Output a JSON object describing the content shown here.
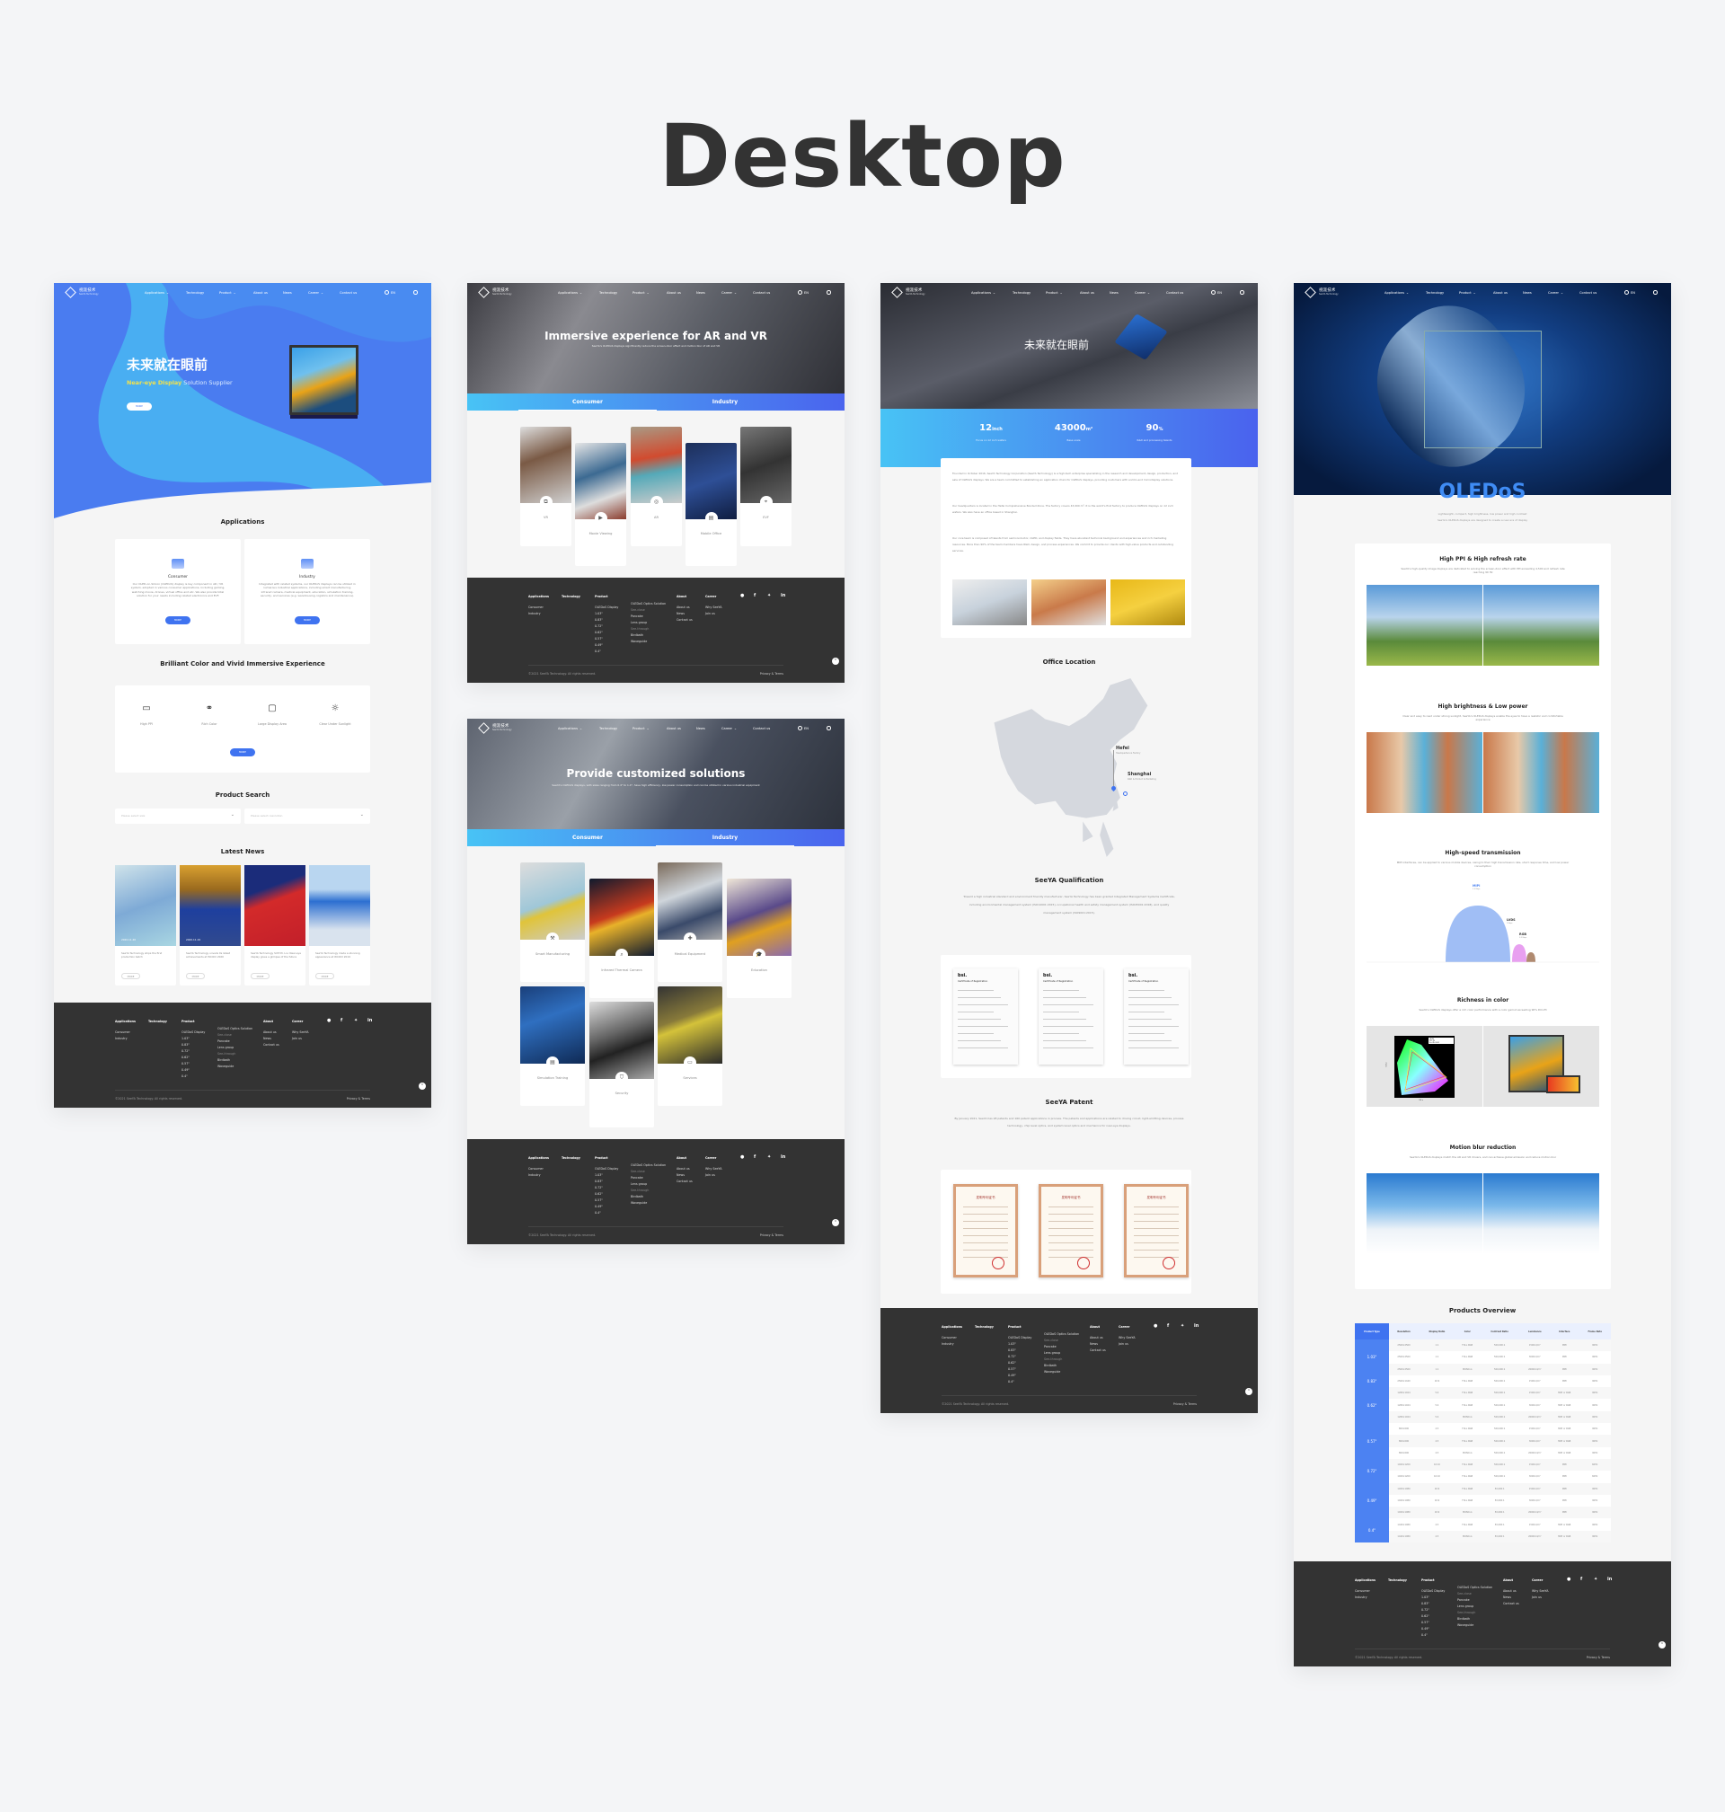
{
  "showcase_title": "Desktop",
  "colors": {
    "brand_blue": "#3f73f0",
    "cyan": "#48c3f5",
    "footer_bg": "#333333",
    "page_bg": "#f4f5f7"
  },
  "nav": {
    "logo_cn": "视涯技术",
    "logo_en": "SeeYA Technology",
    "items": [
      {
        "label": "Applications",
        "dropdown": true
      },
      {
        "label": "Technology",
        "dropdown": false
      },
      {
        "label": "Product",
        "dropdown": true
      },
      {
        "label": "About us",
        "dropdown": false
      },
      {
        "label": "News",
        "dropdown": false
      },
      {
        "label": "Career",
        "dropdown": true
      },
      {
        "label": "Contact us",
        "dropdown": false
      }
    ],
    "lang": "EN",
    "globe_icon": "globe-icon",
    "search_icon": "search-icon"
  },
  "footer": {
    "columns": [
      {
        "title": "Applications",
        "links": [
          {
            "text": "Consumer"
          },
          {
            "text": "Industry"
          }
        ]
      },
      {
        "title": "Technology",
        "links": []
      },
      {
        "title": "Product",
        "links": [
          {
            "text": "OLEDoS Display"
          },
          {
            "text": "1.03\""
          },
          {
            "text": "0.83\""
          },
          {
            "text": "0.72\""
          },
          {
            "text": "0.62\""
          },
          {
            "text": "0.57\""
          },
          {
            "text": "0.49\""
          },
          {
            "text": "0.4\""
          }
        ]
      },
      {
        "title": "",
        "links": [
          {
            "text": "OLEDoS Optics Solution"
          },
          {
            "text": "See-close",
            "sub": true
          },
          {
            "text": "Pancake"
          },
          {
            "text": "Lens group"
          },
          {
            "text": "See-through",
            "sub": true
          },
          {
            "text": "Birdbath"
          },
          {
            "text": "Waveguide"
          }
        ]
      },
      {
        "title": "About",
        "links": [
          {
            "text": "About us"
          },
          {
            "text": "News"
          },
          {
            "text": "Contact us"
          }
        ]
      },
      {
        "title": "Career",
        "links": [
          {
            "text": "Why SeeYA"
          },
          {
            "text": "Join us"
          }
        ]
      }
    ],
    "social": [
      "wechat-icon",
      "facebook-icon",
      "twitter-icon",
      "linkedin-icon"
    ],
    "copyright": "©2021 SeeYA Technology. All rights reserved.",
    "privacy": "Privacy & Terms"
  },
  "home": {
    "hero_title": "未来就在眼前",
    "hero_highlight": "Near-eye Display",
    "hero_subtitle": "Solution Supplier",
    "hero_button": "MORE",
    "applications_title": "Applications",
    "applications": [
      {
        "title": "Consumer",
        "desc": "Our OLED-on-Silicon (OLEDoS) display is key component in AR / VR system, adopted in various consumer applications, including gaming, watching movie, drones, virtual office and etc. We also provide total solution for your needs including related electronics and EVF.",
        "button": "MORE"
      },
      {
        "title": "Industry",
        "desc": "Integrated with related systems, our OLEDoS displays can be utilized in numerous industrial applications, including smart manufacturing, infrared camera, medical equipment, education, simulation training, security, and services (e.g. warehousing, logistics and maintenance).",
        "button": "MORE"
      }
    ],
    "features_title": "Brilliant Color and Vivid Immersive Experience",
    "features": [
      {
        "label": "High PPI",
        "icon": "high-ppi-icon"
      },
      {
        "label": "Rich Color",
        "icon": "rich-color-icon"
      },
      {
        "label": "Large Display Area",
        "icon": "monitor-icon"
      },
      {
        "label": "Clear Under Sunlight",
        "icon": "sun-icon"
      }
    ],
    "features_button": "MORE",
    "search_title": "Product Search",
    "size_placeholder": "Please select size",
    "resolution_placeholder": "Please select resolution",
    "news_title": "Latest News",
    "news": [
      {
        "date": "2020.11.26",
        "title": "SeeYA Technology ships the first production batch",
        "button": "MORE"
      },
      {
        "date": "2020.11.19",
        "title": "SeeYA Technology unveils its latest achievements at WCOCI 2020",
        "button": "MORE"
      },
      {
        "date": "",
        "title": "SeeYA Technology SVP Mr. Liu: Near-eye display gives a glimpse of the future",
        "button": "MORE"
      },
      {
        "date": "",
        "title": "SeeYA Technology made a stunning appearance at WCOCI 2019",
        "button": "MORE"
      }
    ]
  },
  "consumer": {
    "hero_title": "Immersive experience for AR and VR",
    "hero_subtitle": "SeeYA's OLEDoS displays significantly reduce the screen-door effect and motion blur of AR and VR",
    "tabs": [
      "Consumer",
      "Industry"
    ],
    "active_tab": "Consumer",
    "cards": [
      {
        "label": "VR",
        "icon": "vr-headset-icon"
      },
      {
        "label": "Movie Viewing",
        "icon": "play-icon"
      },
      {
        "label": "AR",
        "icon": "ar-icon"
      },
      {
        "label": "Mobile Office",
        "icon": "briefcase-icon"
      },
      {
        "label": "EVF",
        "icon": "viewfinder-icon"
      }
    ]
  },
  "industry": {
    "hero_title": "Provide customized solutions",
    "hero_subtitle": "SeeYA's OLEDoS displays, with sizes ranging from 0.4\" to 1.4\", have high efficiency, low power consumption and can be utilized in various industrial equipment",
    "tabs": [
      "Consumer",
      "Industry"
    ],
    "active_tab": "Industry",
    "cards": [
      {
        "label": "Smart Manufacturing",
        "icon": "wrench-icon"
      },
      {
        "label": "Infrared Thermal Camera",
        "icon": "thermal-icon"
      },
      {
        "label": "Medical Equipment",
        "icon": "medical-kit-icon"
      },
      {
        "label": "Education",
        "icon": "graduation-cap-icon"
      },
      {
        "label": "Simulation Training",
        "icon": "document-icon"
      },
      {
        "label": "Security",
        "icon": "shield-icon"
      },
      {
        "label": "Services",
        "icon": "chat-icon"
      }
    ]
  },
  "about": {
    "hero_title": "未来就在眼前",
    "stats": [
      {
        "value": "12",
        "unit": "inch",
        "label": "Focus on 12 inch wafers"
      },
      {
        "value": "43000",
        "unit": "m²",
        "label": "Base scale"
      },
      {
        "value": "90",
        "unit": "%",
        "label": "R&D and processing talents"
      }
    ],
    "paragraphs": [
      "Founded in October 2016, SeeYA Technology Corporation (SeeYA Technology) is a high-tech enterprise specializing in the research and development, design, production, and sale of OLEDoS displays. We are a team committed to establishing an application chain for OLEDoS displays, providing customers with end-to-end microdisplay solutions.",
      "Our headquarters is located in the Hefei Comprehensive Bonded Zone. The factory covers 43,000 m². It is the world's first factory to produce OLEDoS displays on 12 inch wafers. We also have an office based in Shanghai.",
      "Our core team is composed of talents from semiconductor, OLED, and display fields. They have abundant technical background and experiences and rich marketing resources. More than 90% of the team members have R&D, design, and process experiences. We commit to provide our clients with high-value products and outstanding services."
    ],
    "office_title": "Office Location",
    "offices": [
      {
        "city": "Hefei",
        "desc": "Headquarters & Factory"
      },
      {
        "city": "Shanghai",
        "desc": "R&D & Product & Marketing"
      }
    ],
    "qualification_title": "SeeYA Qualification",
    "qualification_text": "Toward a high industrial standard and environment friendly manufacturer, SeeYA Technology has been granted Integrated Management Systems Certificate, including environmental management system (ISO14001:2015), occupational health and safety management system (ISO45001:2018), and quality management system (ISO9001:2015).",
    "certificate": {
      "brand": "bsi.",
      "title": "Certificate of Registration"
    },
    "patent_title": "SeeYA Patent",
    "patent_text": "By January 2021, SeeYA has 28 patents and 160 patent applications in process. The patents and applications are related to driving circuit, light-emitting devices, process technology, chip level optics, and system level optics and mechanics for near-eye displays.",
    "patent_cert_title": "发明专利证书"
  },
  "product": {
    "hero_title": "OLEDoS",
    "hero_subtitle_1": "Lightweight, compact, high brightness, low power and high contrast",
    "hero_subtitle_2": "SeeYA's OLEDoS displays are designed to create a new era of display",
    "features": [
      {
        "title": "High PPI & High refresh rate",
        "desc": "SeeYA's high-quality image displays are dedicated to solving the screen-door effect with PPI exceeding 4,500 and refresh rate reaching 90 Hz"
      },
      {
        "title": "High brightness & Low power",
        "desc": "Clear and easy to read under strong sunlight, SeeYA's OLEDoS displays enable the eyes to have a realistic and comfortable experience"
      },
      {
        "title": "High-speed transmission",
        "desc": "MIPI interfaces, can be applied to various mobile devices, owing to their high transmission rate, short response time, and low power consumption"
      },
      {
        "title": "Richness in color",
        "desc": "SeeYA's OLEDoS displays offer a rich color performance with a color gamut exceeding 90% DCI-P3"
      },
      {
        "title": "Motion blur reduction",
        "desc": "SeeYA's OLEDoS displays match the AR and VR drivers, and can achieve global emission and reduce motion blur"
      }
    ],
    "transmission": [
      {
        "name": "MIPI",
        "rate": "2.5Gbps"
      },
      {
        "name": "LVDS",
        "rate": "1Gbps"
      },
      {
        "name": "RGB",
        "rate": "0.2Gbps"
      }
    ],
    "gamut": {
      "legend": [
        "sRGB",
        "DCI-P3",
        "SeeYA OLED"
      ],
      "xlabel": "CIE x",
      "ylabel": "CIE y"
    },
    "overview_title": "Products Overview",
    "table": {
      "headers": [
        "Product Type",
        "Resolution",
        "Display Ratio",
        "Color",
        "Contrast Ratio",
        "Luminance",
        "Interface",
        "Frame Rate"
      ],
      "groups": [
        {
          "type": "1.03\"",
          "rows": [
            [
              "2560×2560",
              "1:1",
              "FULL RGB",
              "500,000:1",
              "1500cd/m²",
              "MIPI",
              "90Hz"
            ],
            [
              "2560×2560",
              "1:1",
              "FULL RGB",
              "500,000:1",
              "3000cd/m²",
              "MIPI",
              "90Hz"
            ],
            [
              "2560×2560",
              "1:1",
              "MONO-G",
              "500,000:1",
              "20000cd/m²",
              "MIPI",
              "90Hz"
            ]
          ]
        },
        {
          "type": "0.83\"",
          "rows": [
            [
              "2560×1440",
              "16:9",
              "FULL RGB",
              "500,000:1",
              "1500cd/m²",
              "MIPI",
              "90Hz"
            ]
          ]
        },
        {
          "type": "0.62\"",
          "rows": [
            [
              "1280×1024",
              "5:4",
              "FULL RGB",
              "500,000:1",
              "1500cd/m²",
              "MIPI or RGB",
              "90Hz"
            ],
            [
              "1280×1024",
              "5:4",
              "FULL RGB",
              "500,000:1",
              "3000cd/m²",
              "MIPI or RGB",
              "90Hz"
            ],
            [
              "1280×1024",
              "5:4",
              "MONO-G",
              "500,000:1",
              "20000cd/m²",
              "MIPI or RGB",
              "90Hz"
            ]
          ]
        },
        {
          "type": "0.57\"",
          "rows": [
            [
              "800×600",
              "4:3",
              "FULL RGB",
              "500,000:1",
              "1500cd/m²",
              "MIPI or RGB",
              "90Hz"
            ],
            [
              "800×600",
              "4:3",
              "FULL RGB",
              "500,000:1",
              "3000cd/m²",
              "MIPI or RGB",
              "90Hz"
            ],
            [
              "800×600",
              "4:3",
              "MONO-G",
              "500,000:1",
              "20000cd/m²",
              "MIPI or RGB",
              "90Hz"
            ]
          ]
        },
        {
          "type": "0.72\"",
          "rows": [
            [
              "1920×1200",
              "16:10",
              "FULL RGB",
              "500,000:1",
              "1500cd/m²",
              "MIPI",
              "60Hz"
            ],
            [
              "1920×1200",
              "16:10",
              "FULL RGB",
              "500,000:1",
              "3000cd/m²",
              "MIPI",
              "60Hz"
            ]
          ]
        },
        {
          "type": "0.49\"",
          "rows": [
            [
              "1920×1080",
              "16:9",
              "FULL RGB",
              "50,000:1",
              "1500cd/m²",
              "MIPI",
              "90Hz"
            ],
            [
              "1920×1080",
              "16:9",
              "FULL RGB",
              "50,000:1",
              "3000cd/m²",
              "MIPI",
              "90Hz"
            ],
            [
              "1920×1080",
              "16:9",
              "MONO-G",
              "50,000:1",
              "20000cd/m²",
              "MIPI",
              "90Hz"
            ]
          ]
        },
        {
          "type": "0.4\"",
          "rows": [
            [
              "1440×1080",
              "4:3",
              "FULL RGB",
              "50,000:1",
              "1500cd/m²",
              "MIPI or RGB",
              "90Hz"
            ],
            [
              "1440×1080",
              "4:3",
              "MONO-G",
              "50,000:1",
              "20000cd/m²",
              "MIPI or RGB",
              "90Hz"
            ]
          ]
        }
      ]
    }
  }
}
